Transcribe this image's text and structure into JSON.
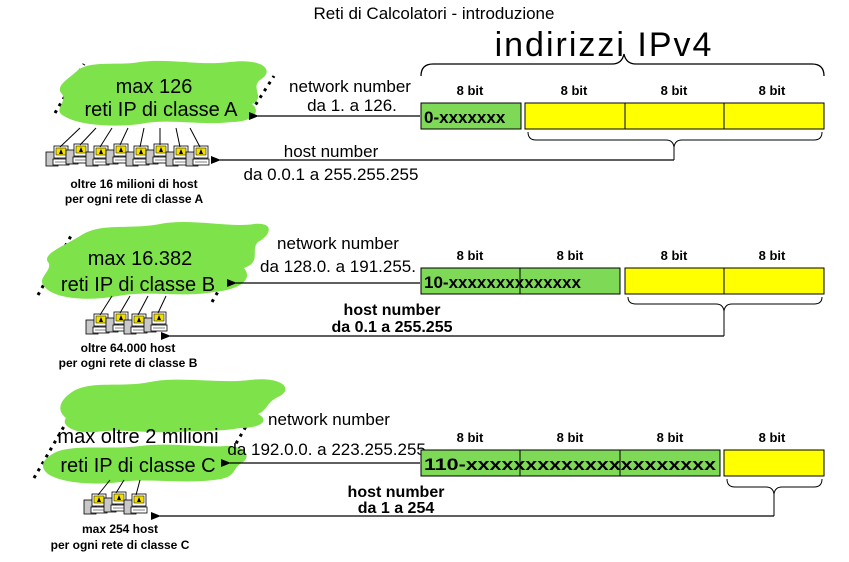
{
  "header": {
    "title": "Reti di Calcolatori - introduzione",
    "subtitle": "indirizzi IPv4"
  },
  "octet_label": "8 bit",
  "colors": {
    "network_field": "#7ed957",
    "host_field": "#ffff00",
    "cloud": "#7ee24a",
    "outline": "#000000"
  },
  "classes": [
    {
      "id": "A",
      "cloud_line1": "max 126",
      "cloud_line2": "reti IP di classe A",
      "network_number_label": "network number",
      "network_number_range": "da 1. a 126.",
      "prefix_field": "0-xxxxxxx",
      "host_number_label": "host number",
      "host_number_range": "da 0.0.1 a 255.255.255",
      "hosts_note_line1": "oltre 16 milioni di host",
      "hosts_note_line2": "per ogni rete di classe A"
    },
    {
      "id": "B",
      "cloud_line1": "max 16.382",
      "cloud_line2": "reti IP di classe B",
      "network_number_label": "network number",
      "network_number_range": "da 128.0. a 191.255.",
      "prefix_field": "10-xxxxxxxxxxxxxx",
      "host_number_label": "host number",
      "host_number_range": "da 0.1 a 255.255",
      "hosts_note_line1": "oltre 64.000 host",
      "hosts_note_line2": "per ogni rete di classe B"
    },
    {
      "id": "C",
      "cloud_line1": "max oltre 2 milioni",
      "cloud_line2": "reti IP di classe C",
      "network_number_label": "network number",
      "network_number_range": "da 192.0.0. a 223.255.255.",
      "prefix_field": "110-xxxxxxxxxxxxxxxxxxxxx",
      "host_number_label": "host number",
      "host_number_range": "da 1 a 254",
      "hosts_note_line1": "max 254 host",
      "hosts_note_line2": "per ogni rete di classe C"
    }
  ]
}
